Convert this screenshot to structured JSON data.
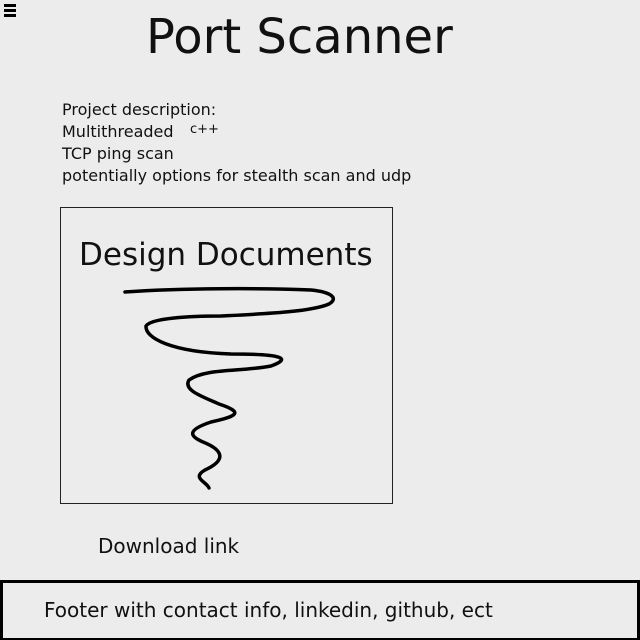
{
  "header": {
    "title": "Port Scanner"
  },
  "description": {
    "lines": [
      "Project description:",
      "Multithreaded",
      "TCP ping scan",
      "potentially options for stealth scan and udp"
    ],
    "note": "c++"
  },
  "design_section": {
    "title": "Design Documents"
  },
  "download": {
    "label": "Download link"
  },
  "footer": {
    "text": "Footer with contact info, linkedin, github, ect"
  },
  "icons": {
    "menu": "hamburger-menu-icon",
    "drawing": "squiggle-sketch"
  }
}
